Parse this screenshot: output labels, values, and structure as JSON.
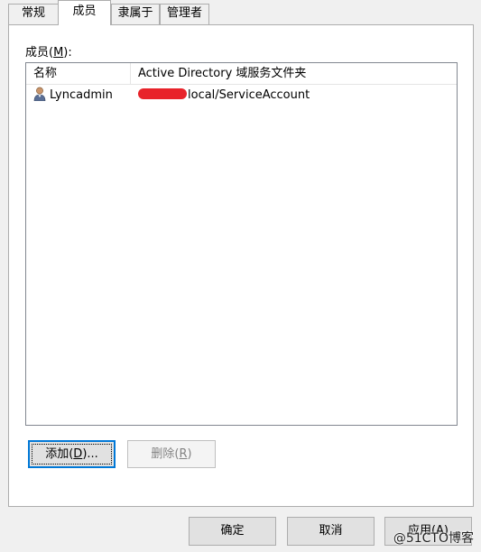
{
  "tabs": [
    {
      "label": "常规",
      "selected": false
    },
    {
      "label": "成员",
      "selected": true
    },
    {
      "label": "隶属于",
      "selected": false
    },
    {
      "label": "管理者",
      "selected": false
    }
  ],
  "members": {
    "label_prefix": "成员(",
    "label_key": "M",
    "label_suffix": "):",
    "columns": [
      "名称",
      "Active Directory 域服务文件夹"
    ],
    "rows": [
      {
        "name": "Lyncadmin",
        "folder": "local/ServiceAccount",
        "icon": "user-icon",
        "folder_redacted": true
      }
    ]
  },
  "buttons": {
    "add": {
      "prefix": "添加(",
      "key": "D",
      "suffix": ")..."
    },
    "remove": {
      "prefix": "删除(",
      "key": "R",
      "suffix": ")"
    },
    "ok": "确定",
    "cancel": "取消",
    "apply": "应用(A)"
  },
  "watermark": "@51CTO博客",
  "colors": {
    "focus_border": "#0078d7",
    "redaction": "#e8232a"
  }
}
